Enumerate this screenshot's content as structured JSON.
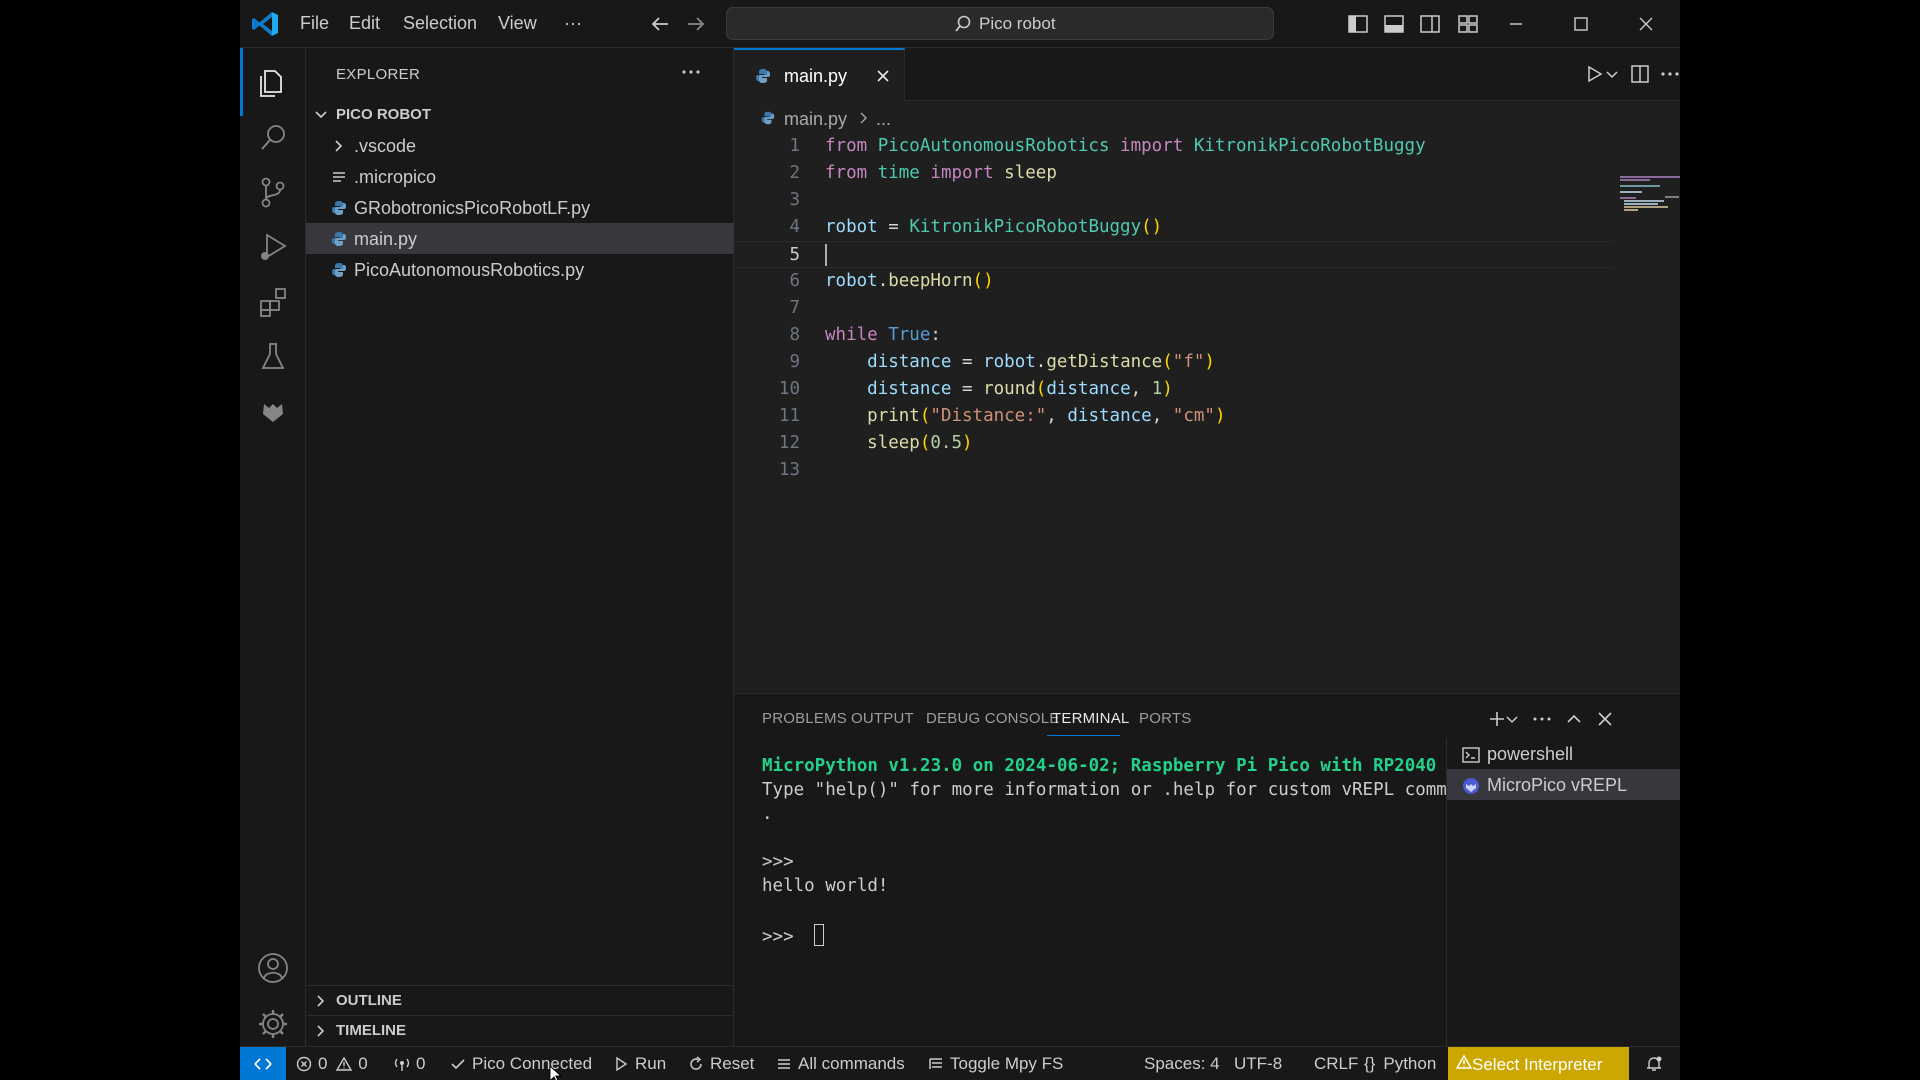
{
  "titlebar": {
    "menu": [
      "File",
      "Edit",
      "Selection",
      "View",
      "···"
    ],
    "command_center": "Pico robot"
  },
  "sidebar": {
    "title": "EXPLORER",
    "folder": "PICO ROBOT",
    "items": [
      {
        "label": ".vscode",
        "type": "folder"
      },
      {
        "label": ".micropico",
        "type": "file"
      },
      {
        "label": "GRobotronicsPicoRobotLF.py",
        "type": "python"
      },
      {
        "label": "main.py",
        "type": "python",
        "selected": true
      },
      {
        "label": "PicoAutonomousRobotics.py",
        "type": "python"
      }
    ],
    "outline": "OUTLINE",
    "timeline": "TIMELINE"
  },
  "editor": {
    "tab": "main.py",
    "breadcrumb": [
      "main.py",
      "..."
    ],
    "line_numbers": [
      "1",
      "2",
      "3",
      "4",
      "5",
      "6",
      "7",
      "8",
      "9",
      "10",
      "11",
      "12",
      "13"
    ],
    "code": {
      "l1": {
        "k1": "from",
        "mod": "PicoAutonomousRobotics",
        "k2": "import",
        "cls": "KitronikPicoRobotBuggy"
      },
      "l2": {
        "k1": "from",
        "mod": "time",
        "k2": "import",
        "fn": "sleep"
      },
      "l4": {
        "var": "robot",
        "op": "=",
        "cls": "KitronikPicoRobotBuggy",
        "p": "()"
      },
      "l6": {
        "var": "robot",
        "dot": ".",
        "fn": "beepHorn",
        "p": "()"
      },
      "l8": {
        "kw": "while",
        "bool": "True",
        "colon": ":"
      },
      "l9": {
        "var": "distance",
        "op": "=",
        "obj": "robot",
        "dot": ".",
        "fn": "getDistance",
        "po": "(",
        "str": "\"f\"",
        "pc": ")"
      },
      "l10": {
        "var": "distance",
        "op": "=",
        "fn": "round",
        "po": "(",
        "arg": "distance",
        "comma": ",",
        "num": "1",
        "pc": ")"
      },
      "l11": {
        "fn": "print",
        "po": "(",
        "s1": "\"Distance:\"",
        "c1": ",",
        "arg": "distance",
        "c2": ",",
        "s2": "\"cm\"",
        "pc": ")"
      },
      "l12": {
        "fn": "sleep",
        "po": "(",
        "num": "0.5",
        "pc": ")"
      }
    }
  },
  "panel": {
    "tabs": [
      "PROBLEMS",
      "OUTPUT",
      "DEBUG CONSOLE",
      "TERMINAL",
      "PORTS"
    ],
    "active_tab": "TERMINAL",
    "terminal_lines": [
      "MicroPython v1.23.0 on 2024-06-02; Raspberry Pi Pico with RP2040",
      "Type \"help()\" for more information or .help for custom vREPL commands",
      ".",
      ">>>",
      "hello world!",
      ">>> "
    ],
    "terminals": [
      "powershell",
      "MicroPico vREPL"
    ]
  },
  "statusbar": {
    "errors": "0",
    "warnings": "0",
    "ports": "0",
    "pico": "Pico Connected",
    "run": "Run",
    "reset": "Reset",
    "all_commands": "All commands",
    "toggle_fs": "Toggle Mpy FS",
    "spaces": "Spaces: 4",
    "encoding": "UTF-8",
    "eol": "CRLF",
    "language_brace": "{}",
    "language": "Python",
    "interpreter": "Select Interpreter"
  },
  "colors": {
    "accent": "#0078d4",
    "warning_bg": "#cca700",
    "terminal_green": "#23d18b"
  }
}
